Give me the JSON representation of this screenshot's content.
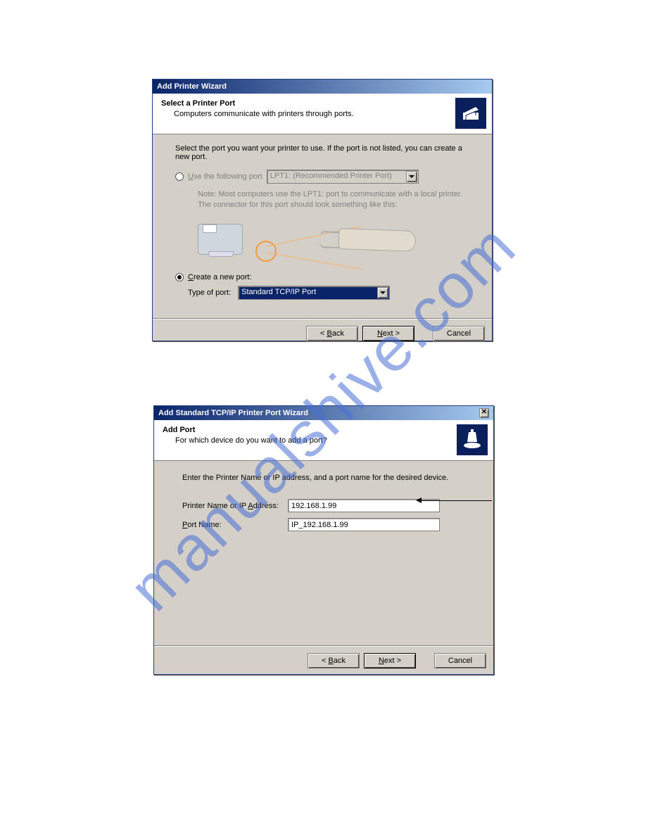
{
  "watermark": "manualshive.com",
  "dialog1": {
    "title": "Add Printer Wizard",
    "header_title": "Select a Printer Port",
    "header_sub": "Computers communicate with printers through ports.",
    "instruction": "Select the port you want your printer to use.  If the port is not listed, you can create a new port.",
    "radio_use_label_pre": "U",
    "radio_use_label_post": "se the following port",
    "combo_disabled_text": "LPT1: (Recommended Printer Port)",
    "note_line1": "Note: Most computers use the LPT1: port to communicate with a local printer.",
    "note_line2": "The connector for this port should look something like this:",
    "radio_create_label_pre": "C",
    "radio_create_label_post": "reate a new port:",
    "type_of_port_label": "Type of port:",
    "combo_sel_text": "Standard TCP/IP Port",
    "btn_back_pre": "< ",
    "btn_back_ul": "B",
    "btn_back_post": "ack",
    "btn_next_ul": "N",
    "btn_next_post": "ext >",
    "btn_cancel": "Cancel"
  },
  "dialog2": {
    "title": "Add Standard TCP/IP Printer Port Wizard",
    "header_title": "Add Port",
    "header_sub": "For which device do you want to add a port?",
    "instruction": "Enter the Printer Name or IP address, and a port name for the desired device.",
    "addr_label_pre": "Printer Name or IP ",
    "addr_label_ul": "A",
    "addr_label_post": "ddress:",
    "addr_value": "192.168.1.99",
    "port_label_ul": "P",
    "port_label_post": "ort Name:",
    "port_value": "IP_192.168.1.99",
    "btn_back_pre": "< ",
    "btn_back_ul": "B",
    "btn_back_post": "ack",
    "btn_next_ul": "N",
    "btn_next_post": "ext >",
    "btn_cancel": "Cancel"
  }
}
